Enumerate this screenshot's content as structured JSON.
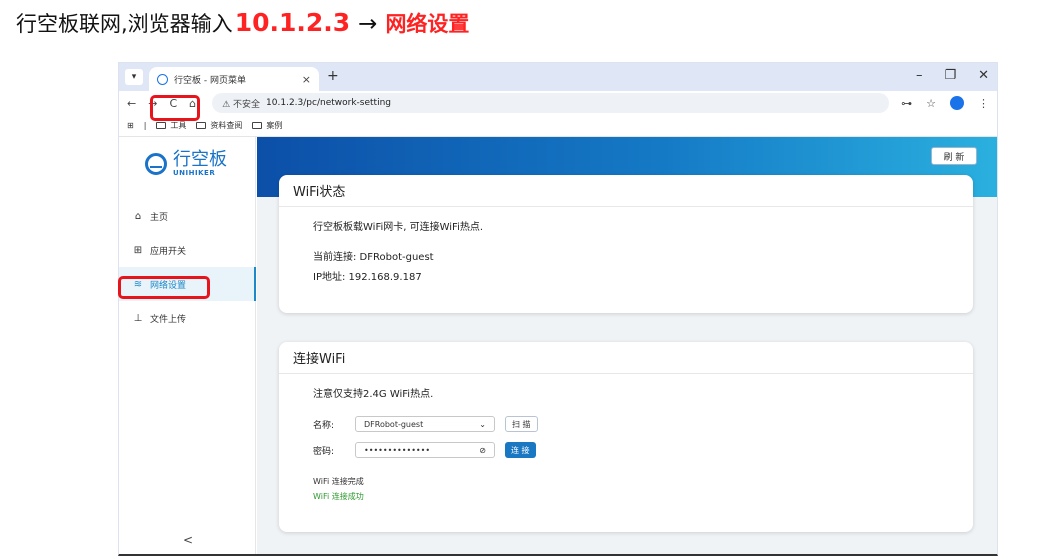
{
  "caption": {
    "text": "行空板联网,浏览器输入",
    "ip": "10.1.2.3",
    "arrow": "→",
    "target": "网络设置"
  },
  "browser": {
    "tab_title": "行空板 - 网页菜单",
    "tab_close": "×",
    "new_tab": "+",
    "window_controls": [
      "–",
      "❐",
      "✕"
    ],
    "nav_buttons": [
      "←",
      "→",
      "C",
      "⌂"
    ],
    "unsafe_label": "⚠ 不安全",
    "url": "10.1.2.3/pc/network-setting",
    "bookmarks": [
      "工具",
      "资料查阅",
      "案例"
    ],
    "addr_icons": [
      "⊶",
      "☆",
      "⋮"
    ]
  },
  "sidebar": {
    "logo_cn": "行空板",
    "logo_en": "UNIHIKER",
    "items": [
      {
        "icon": "⌂",
        "label": "主页"
      },
      {
        "icon": "⊞",
        "label": "应用开关"
      },
      {
        "icon": "≋",
        "label": "网络设置"
      },
      {
        "icon": "⊥",
        "label": "文件上传"
      }
    ],
    "collapse": "<"
  },
  "main": {
    "refresh_label": "刷 新",
    "wifi_status": {
      "title": "WiFi状态",
      "desc": "行空板板载WiFi网卡, 可连接WiFi热点.",
      "current": "当前连接: DFRobot-guest",
      "ip": "IP地址: 192.168.9.187"
    },
    "connect": {
      "title": "连接WiFi",
      "note": "注意仅支持2.4G WiFi热点.",
      "name_label": "名称:",
      "name_value": "DFRobot-guest",
      "scan_label": "扫 描",
      "pwd_label": "密码:",
      "pwd_value": "••••••••••••••",
      "connect_label": "连 接",
      "status_done": "WiFi 连接完成",
      "status_ok": "WiFi 连接成功"
    }
  },
  "colors": {
    "highlight": "#e8141c",
    "accent": "#1a78c2",
    "success": "#2e9a2e"
  }
}
